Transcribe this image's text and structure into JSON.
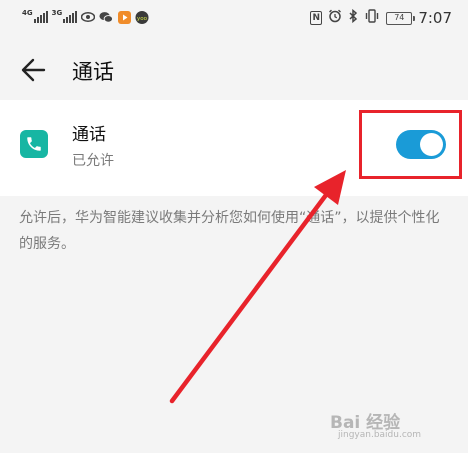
{
  "status_bar": {
    "signal1_label": "4G",
    "signal2_label": "3G",
    "battery_level": "74",
    "time": "7:07",
    "app_badge": "yoo"
  },
  "header": {
    "title": "通话"
  },
  "permission": {
    "name": "通话",
    "status": "已允许",
    "enabled": true
  },
  "description": "允许后，华为智能建议收集并分析您如何使用“通话”，以提供个性化的服务。",
  "watermark": {
    "brand": "Bai 经验",
    "url": "jingyan.baidu.com"
  },
  "colors": {
    "accent": "#1a9bd7",
    "app_icon": "#17b6a3",
    "annotation": "#e8232b"
  }
}
